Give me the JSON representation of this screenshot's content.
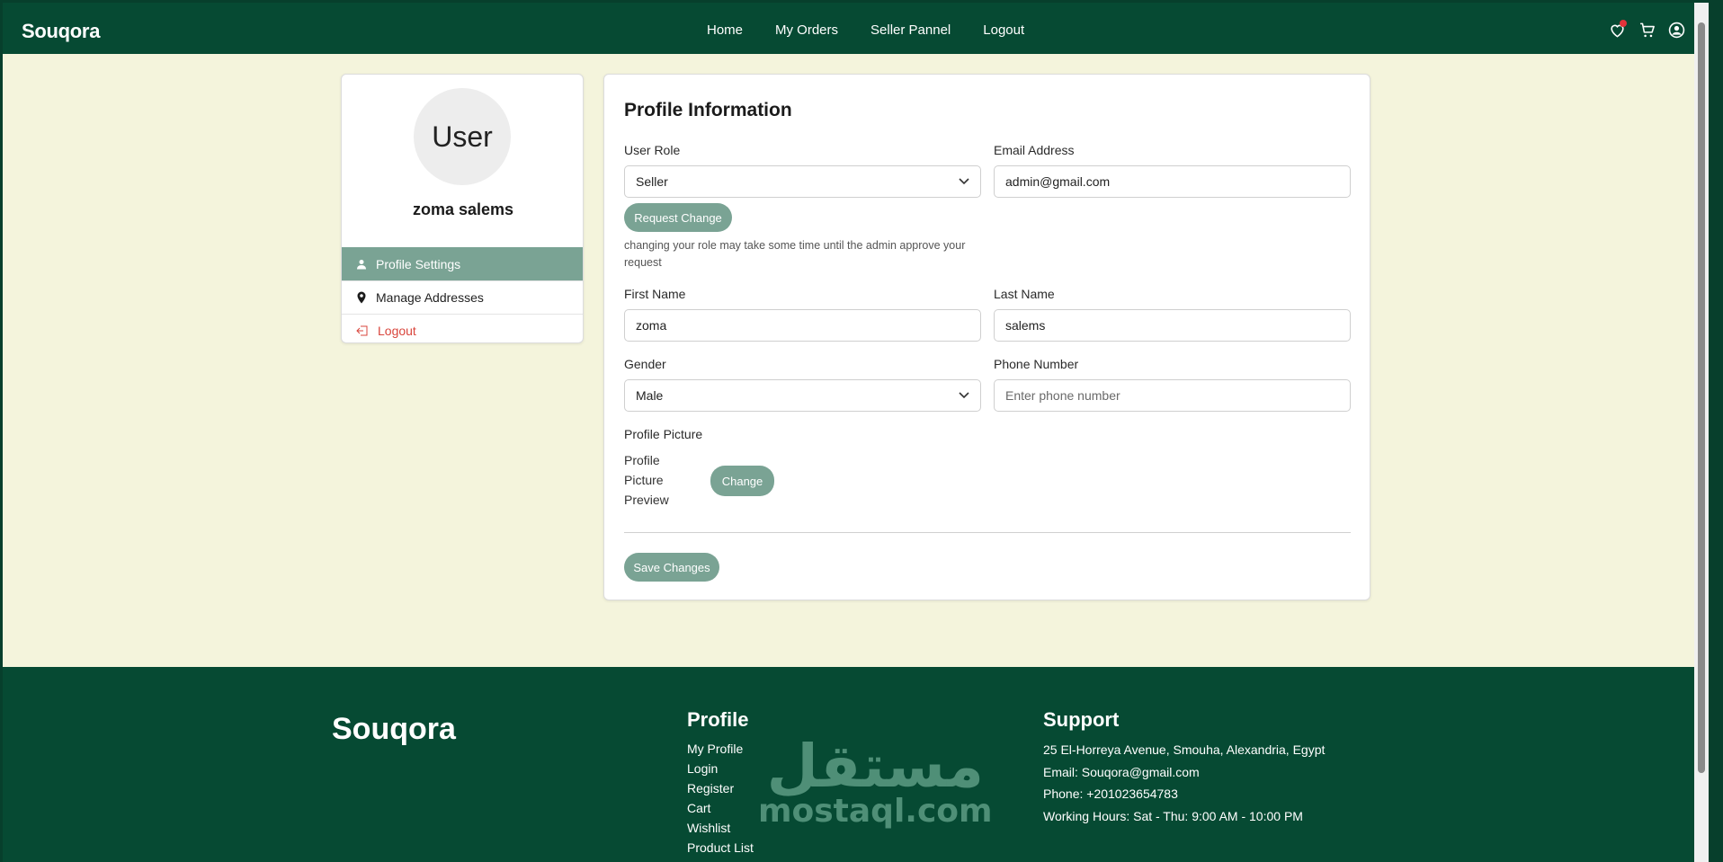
{
  "nav": {
    "brand": "Souqora",
    "links": [
      "Home",
      "My Orders",
      "Seller Pannel",
      "Logout"
    ],
    "icons": [
      "heart-icon",
      "cart-icon",
      "user-circle-icon"
    ],
    "accent": "#064a33"
  },
  "sidebar": {
    "avatar_text": "User",
    "user_name": "zoma salems",
    "menu": [
      {
        "label": "Profile Settings",
        "icon": "person-icon",
        "active": true
      },
      {
        "label": "Manage Addresses",
        "icon": "location-pin-icon",
        "active": false
      },
      {
        "label": "Logout",
        "icon": "logout-icon",
        "active": false
      }
    ]
  },
  "profile": {
    "title": "Profile Information",
    "user_role": {
      "label": "User Role",
      "value": "Seller"
    },
    "email": {
      "label": "Email Address",
      "value": "admin@gmail.com"
    },
    "request_change_label": "Request Change",
    "role_hint": "changing your role may take some time until the admin approve your request",
    "first_name": {
      "label": "First Name",
      "value": "zoma"
    },
    "last_name": {
      "label": "Last Name",
      "value": "salems"
    },
    "gender": {
      "label": "Gender",
      "value": "Male"
    },
    "phone": {
      "label": "Phone Number",
      "placeholder": "Enter phone number"
    },
    "picture": {
      "label": "Profile Picture",
      "alt_text": "Profile Picture Preview",
      "change_label": "Change"
    },
    "save_label": "Save Changes",
    "button_color": "#7aa394"
  },
  "footer": {
    "brand": "Souqora",
    "profile_title": "Profile",
    "profile_links": [
      "My Profile",
      "Login",
      "Register",
      "Cart",
      "Wishlist",
      "Product List"
    ],
    "support_title": "Support",
    "address": "25 El-Horreya Avenue, Smouha, Alexandria, Egypt",
    "email": "Email: Souqora@gmail.com",
    "phone": "Phone: +201023654783",
    "hours": "Working Hours: Sat - Thu: 9:00 AM - 10:00 PM"
  },
  "watermark": {
    "arabic": "مستقل",
    "latin": "mostaql.com"
  }
}
